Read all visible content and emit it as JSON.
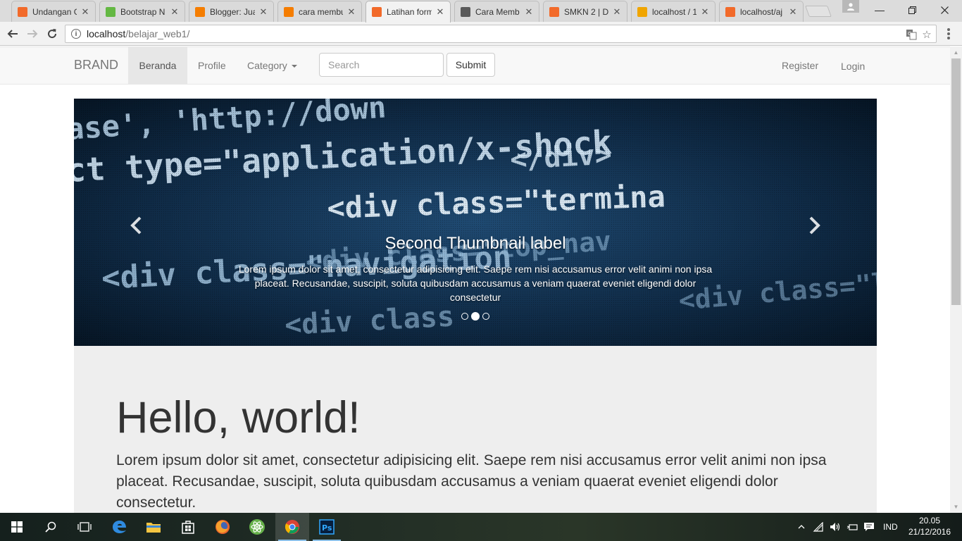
{
  "browser": {
    "tabs": [
      {
        "title": "Undangan G",
        "icon": "xampp-icon",
        "color": "#f26a2a",
        "active": false
      },
      {
        "title": "Bootstrap N",
        "icon": "w3schools-icon",
        "color": "#64b843",
        "active": false
      },
      {
        "title": "Blogger: Jua",
        "icon": "blogger-icon",
        "color": "#f57d00",
        "active": false
      },
      {
        "title": "cara membu",
        "icon": "blogger-icon",
        "color": "#f57d00",
        "active": false
      },
      {
        "title": "Latihan form",
        "icon": "xampp-icon",
        "color": "#f26a2a",
        "active": true
      },
      {
        "title": "Cara Memb",
        "icon": "google-icon",
        "color": "#5a5a5a",
        "active": false
      },
      {
        "title": "SMKN 2 | Da",
        "icon": "xampp-icon",
        "color": "#f26a2a",
        "active": false
      },
      {
        "title": "localhost / 1",
        "icon": "phpmyadmin-icon",
        "color": "#f0a500",
        "active": false
      },
      {
        "title": "localhost/aj",
        "icon": "xampp-icon",
        "color": "#f26a2a",
        "active": false
      }
    ],
    "url_host": "localhost",
    "url_path": "/belajar_web1/"
  },
  "navbar": {
    "brand": "BRAND",
    "links": [
      "Beranda",
      "Profile",
      "Category"
    ],
    "search_placeholder": "Search",
    "submit_label": "Submit",
    "register_label": "Register",
    "login_label": "Login"
  },
  "carousel": {
    "caption_title": "Second Thumbnail label",
    "caption_text": "Lorem ipsum dolor sit amet, consectetur adipisicing elit. Saepe rem nisi accusamus error velit animi non ipsa placeat. Recusandae, suscipit, soluta quibusdam accusamus a veniam quaerat eveniet eligendi dolor consectetur",
    "slide_count": 3,
    "active_slide": 2,
    "code_lines": [
      "ase', 'http://down",
      "ct type=\"application/x-shock",
      "</div>",
      "<div class=\"termina",
      "<div class=\"navigation",
      "<div class=\"top_nav",
      "<div class=\"login",
      "<div class"
    ]
  },
  "jumbotron": {
    "heading": "Hello, world!",
    "text": "Lorem ipsum dolor sit amet, consectetur adipisicing elit. Saepe rem nisi accusamus error velit animi non ipsa placeat. Recusandae, suscipit, soluta quibusdam accusamus a veniam quaerat eveniet eligendi dolor consectetur."
  },
  "taskbar": {
    "language": "IND",
    "time": "20.05",
    "date": "21/12/2016"
  }
}
